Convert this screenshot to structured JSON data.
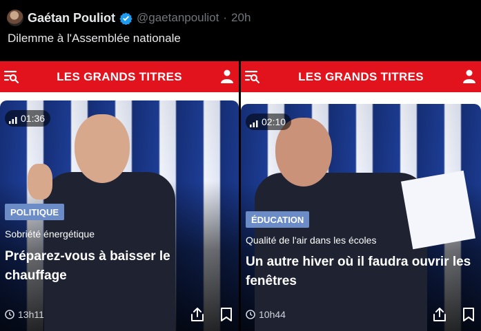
{
  "tweet": {
    "author_name": "Gaétan Pouliot",
    "handle": "@gaetanpouliot",
    "separator": "·",
    "time": "20h",
    "text": "Dilemme à l'Assemblée nationale"
  },
  "cards": [
    {
      "brand": "LES GRANDS TITRES",
      "duration": "01:36",
      "category": "POLITIQUE",
      "subtitle": "Sobriété énergétique",
      "headline": "Préparez-vous à baisser le chauffage",
      "published": "13h11",
      "icons": [
        "menu-search-icon",
        "user-icon",
        "bars-icon",
        "clock-icon",
        "share-icon",
        "bookmark-icon"
      ]
    },
    {
      "brand": "LES GRANDS TITRES",
      "duration": "02:10",
      "category": "ÉDUCATION",
      "subtitle": "Qualité de l'air dans les écoles",
      "headline": "Un autre hiver où il faudra ouvrir les fenêtres",
      "published": "10h44",
      "icons": [
        "menu-search-icon",
        "user-icon",
        "bars-icon",
        "clock-icon",
        "share-icon",
        "bookmark-icon"
      ]
    }
  ],
  "colors": {
    "brand_red": "#e2131c",
    "category_blue": "#6b8cc7",
    "verified_blue": "#1d9bf0",
    "muted_text": "#71767b"
  }
}
